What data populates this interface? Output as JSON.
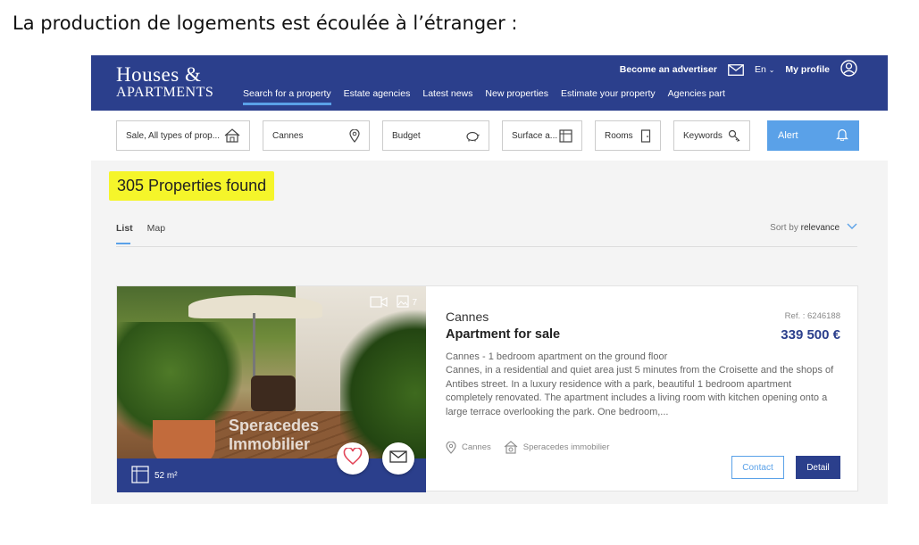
{
  "caption": "La production de logements est écoulée à l’étranger :",
  "header": {
    "logo_line1": "Houses &",
    "logo_line2": "APARTMENTS",
    "become_advertiser": "Become an advertiser",
    "language": "En",
    "my_profile": "My profile",
    "nav": [
      "Search for a property",
      "Estate agencies",
      "Latest news",
      "New properties",
      "Estimate your property",
      "Agencies part"
    ]
  },
  "filters": {
    "type": "Sale, All types of prop...",
    "location": "Cannes",
    "budget": "Budget",
    "surface": "Surface a...",
    "rooms": "Rooms",
    "keywords": "Keywords",
    "alert": "Alert"
  },
  "results": {
    "count_text": "305 Properties found",
    "tab_list": "List",
    "tab_map": "Map",
    "sort_prefix": "Sort by",
    "sort_value": "relevance"
  },
  "listing": {
    "photo_count": "7",
    "watermark_line1": "Speracedes",
    "watermark_line2": "Immobilier",
    "surface": "52 m²",
    "city": "Cannes",
    "type": "Apartment for sale",
    "ref": "Ref. : 6246188",
    "price": "339 500 €",
    "description_title": "Cannes - 1 bedroom apartment on the ground floor",
    "description": "Cannes, in a residential and quiet area just 5 minutes from the Croisette and the shops of Antibes street. In a luxury residence with a park, beautiful 1 bedroom apartment completely renovated. The apartment includes a living room with kitchen opening onto a large terrace overlooking the park. One bedroom,...",
    "meta_location": "Cannes",
    "meta_agency": "Speracedes immobilier",
    "contact_label": "Contact",
    "detail_label": "Detail"
  },
  "colors": {
    "brand_blue": "#2b3f8c",
    "accent_blue": "#5aa1e8",
    "highlight_yellow": "#f5f52a"
  }
}
